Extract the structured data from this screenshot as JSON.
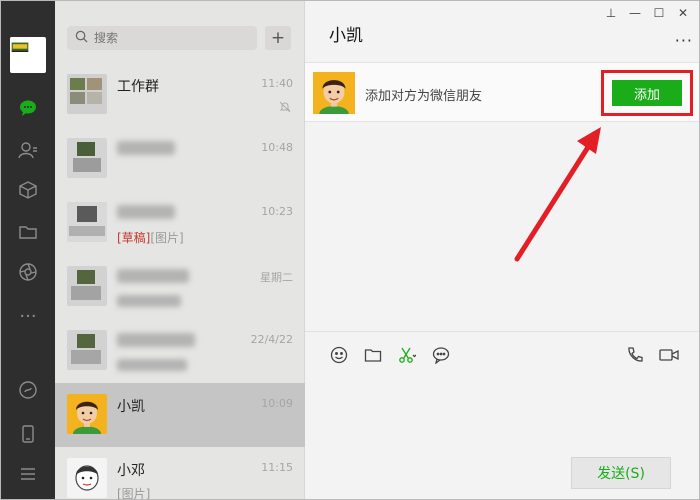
{
  "search": {
    "placeholder": "搜索"
  },
  "list": {
    "plus_label": "+",
    "conversations": [
      {
        "name": "工作群",
        "time": "11:40",
        "sub": "",
        "muted": true
      },
      {
        "name": "",
        "time": "10:48",
        "sub": ""
      },
      {
        "name": "",
        "time": "10:23",
        "draft": "[草稿]",
        "sub": "[图片]"
      },
      {
        "name": "",
        "time": "星期二",
        "sub": ""
      },
      {
        "name": "",
        "time": "22/4/22",
        "sub": ""
      },
      {
        "name": "小凯",
        "time": "10:09",
        "sub": "",
        "selected": true
      },
      {
        "name": "小邓",
        "time": "11:15",
        "sub": "[图片]"
      }
    ]
  },
  "chat": {
    "title": "小凯",
    "more": "···",
    "friend_prompt": "添加对方为微信朋友",
    "add_label": "添加",
    "send_label": "发送(S)"
  },
  "window": {
    "pin": "⊥",
    "minimize": "—",
    "maximize": "☐",
    "close": "✕"
  },
  "colors": {
    "accent": "#1aad19",
    "highlight": "#e31e24",
    "rail": "#2e2e2e"
  }
}
